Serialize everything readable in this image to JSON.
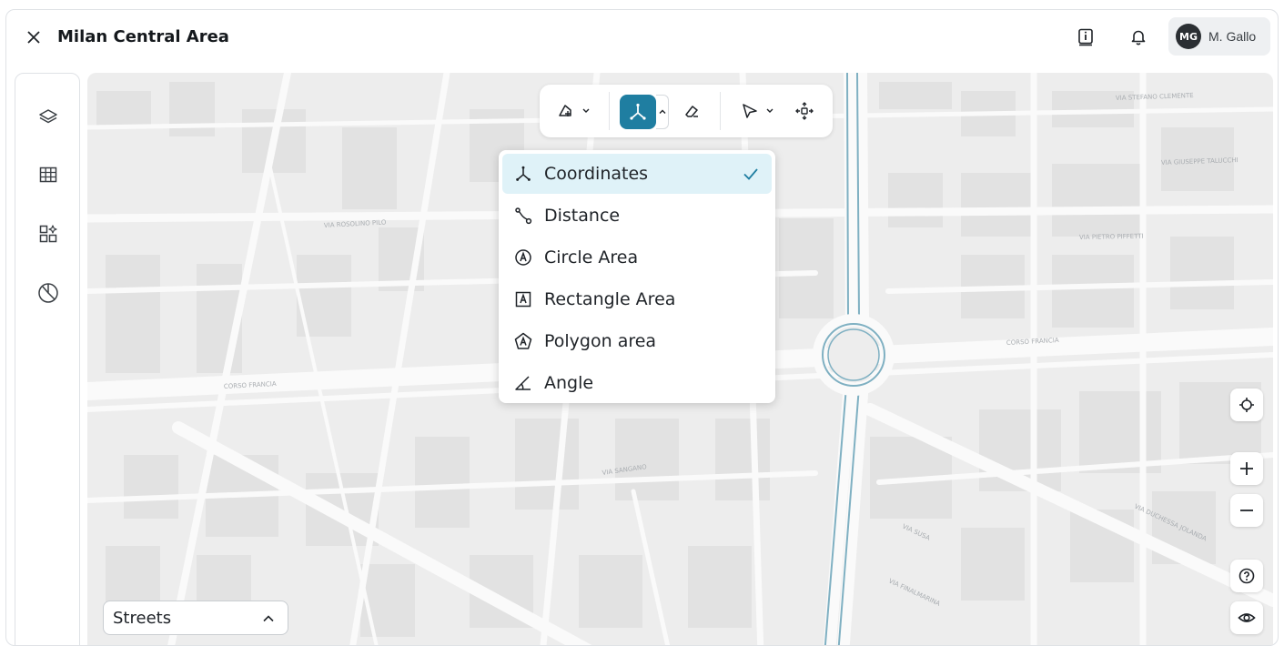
{
  "header": {
    "title": "Milan Central Area",
    "user": {
      "initials": "MG",
      "name": "M. Gallo"
    },
    "icons": {
      "close": "close-icon",
      "info": "info-icon",
      "notifications": "bell-icon"
    }
  },
  "sidebar": {
    "items": [
      {
        "icon": "layers-icon"
      },
      {
        "icon": "table-icon"
      },
      {
        "icon": "widgets-add-icon"
      },
      {
        "icon": "pie-chart-icon"
      }
    ]
  },
  "toolbar": {
    "draw_tool": "draw-shape-icon",
    "measure_tool": "measure-coordinates-icon",
    "erase_tool": "eraser-icon",
    "select_tool": "pointer-icon",
    "pan_tool": "move-icon",
    "accent": "#1f7ea1"
  },
  "measure_menu": {
    "items": [
      {
        "label": "Coordinates",
        "icon": "coordinates-icon",
        "selected": true
      },
      {
        "label": "Distance",
        "icon": "distance-icon",
        "selected": false
      },
      {
        "label": "Circle Area",
        "icon": "circle-area-icon",
        "selected": false
      },
      {
        "label": "Rectangle Area",
        "icon": "rectangle-area-icon",
        "selected": false
      },
      {
        "label": "Polygon area",
        "icon": "polygon-area-icon",
        "selected": false
      },
      {
        "label": "Angle",
        "icon": "angle-icon",
        "selected": false
      }
    ],
    "selected_bg": "#dff2f8"
  },
  "map_controls": {
    "locate": "crosshair-icon",
    "zoom_in": "plus-icon",
    "zoom_out": "minus-icon",
    "help": "help-icon",
    "visibility": "eye-icon"
  },
  "basemap": {
    "selected": "Streets"
  },
  "map_labels": [
    "CORSO FRANCIA",
    "VIA PIETRO PIFFETTI",
    "VIA GIUSEPPE TALUCCHI",
    "VIA SANGANO",
    "VIA SUSA",
    "VIA DUCHESSA JOLANDA",
    "VIA ROSOLINO PILO",
    "VIA STEFANO CLEMENTE",
    "VIA FINALMARINA"
  ]
}
